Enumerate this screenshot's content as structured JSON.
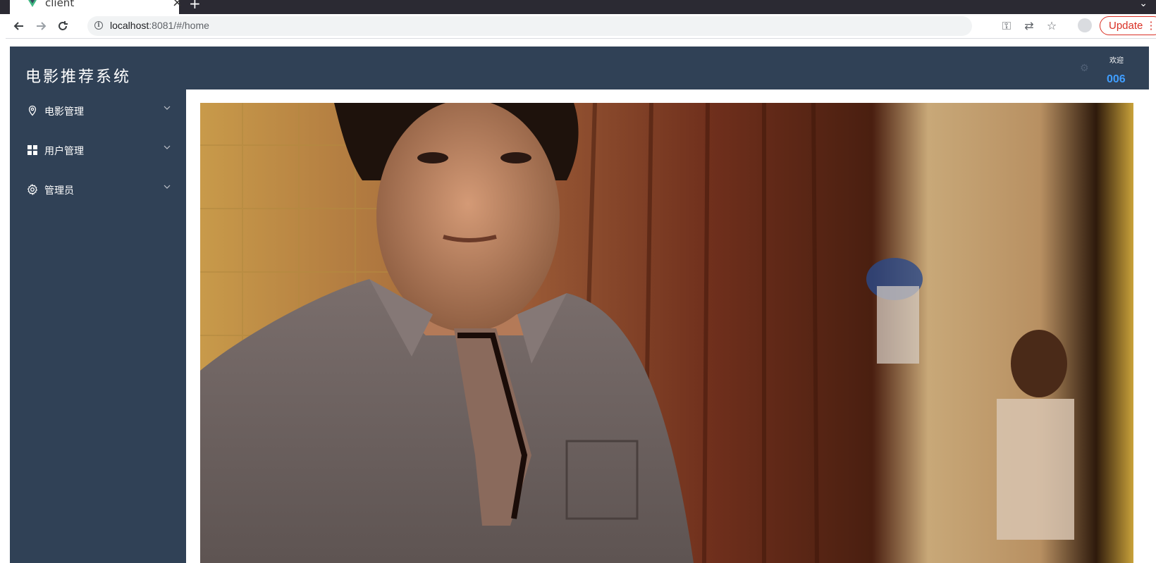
{
  "browser": {
    "tab_title": "client",
    "url_host": "localhost",
    "url_rest": ":8081/#/home",
    "update_label": "Update"
  },
  "app": {
    "title": "电影推荐系统",
    "welcome": "欢迎",
    "username": "006",
    "accent_color": "#409eff",
    "nav_bg_color": "#304156"
  },
  "sidebar": {
    "items": [
      {
        "label": "电影管理",
        "icon": "location-icon"
      },
      {
        "label": "用户管理",
        "icon": "grid-icon"
      },
      {
        "label": "管理员",
        "icon": "gear-icon"
      }
    ]
  },
  "main": {
    "image": "movie-still-photo"
  }
}
